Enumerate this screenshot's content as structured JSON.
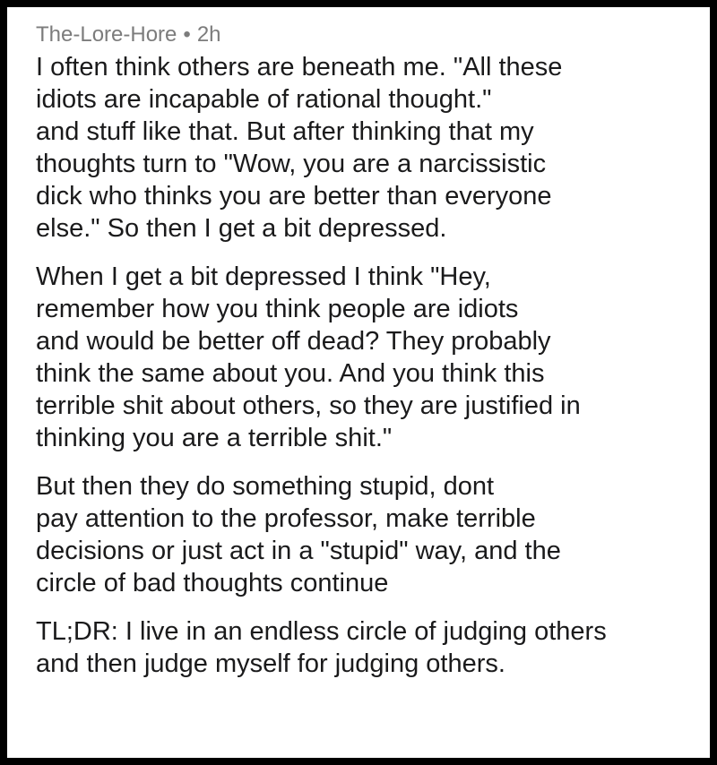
{
  "comment": {
    "author": "The-Lore-Hore",
    "separator": "•",
    "age": "2h",
    "paragraphs": [
      [
        "I often think others are beneath me. \"All these",
        "idiots are incapable of rational thought.\"",
        "and stuff like that. But after thinking that my",
        "thoughts turn to \"Wow, you are a narcissistic",
        "dick who thinks you are better than everyone",
        "else.\" So then I get a bit depressed."
      ],
      [
        "When I get a bit depressed I think \"Hey,",
        "remember how you think people are idiots",
        "and would be better off dead? They probably",
        "think the same about you. And you think this",
        "terrible shit about others, so they are justified in",
        "thinking you are a terrible shit.\""
      ],
      [
        "But then they do something stupid, dont",
        "pay attention to the professor, make terrible",
        "decisions or just act in a \"stupid\" way, and the",
        "circle of bad thoughts continue"
      ],
      [
        "TL;DR: I live in an endless circle of judging others",
        "and then judge myself for judging others."
      ]
    ]
  }
}
